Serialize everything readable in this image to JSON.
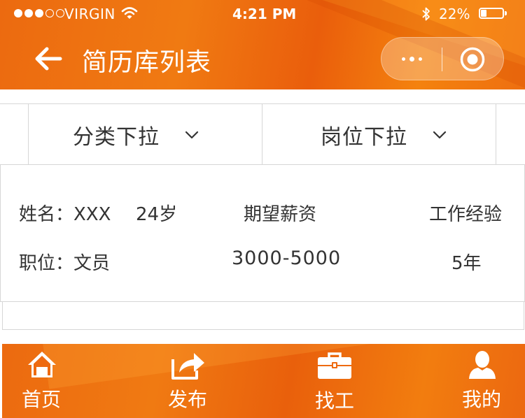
{
  "status_bar": {
    "carrier": "VIRGIN",
    "time": "4:21 PM",
    "battery": "22%"
  },
  "nav": {
    "title": "简历库列表"
  },
  "filters": {
    "category": "分类下拉",
    "position": "岗位下拉"
  },
  "resume": {
    "name_label": "姓名：XXX",
    "age": "24岁",
    "salary_header": "期望薪资",
    "experience_header": "工作经验",
    "job_label": "职位：文员",
    "salary_value": "3000-5000",
    "experience_value": "5年"
  },
  "tabbar": {
    "items": [
      {
        "label": "首页",
        "icon": "home-icon"
      },
      {
        "label": "发布",
        "icon": "share-icon"
      },
      {
        "label": "找工",
        "icon": "briefcase-icon"
      },
      {
        "label": "我的",
        "icon": "user-icon"
      }
    ]
  },
  "colors": {
    "brand_orange": "#ee6a10",
    "text": "#333333",
    "border": "#d6d6d6"
  }
}
